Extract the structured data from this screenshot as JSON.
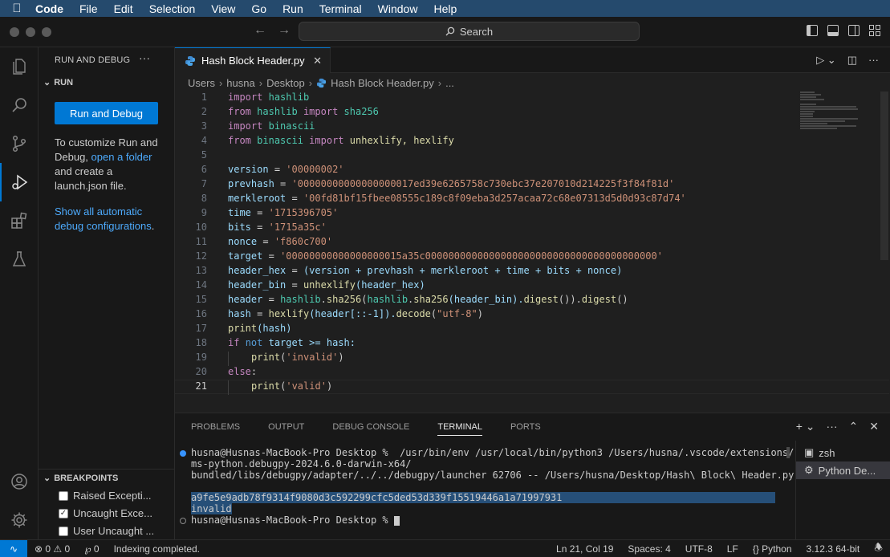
{
  "menubar": {
    "app": "Code",
    "items": [
      "File",
      "Edit",
      "Selection",
      "View",
      "Go",
      "Run",
      "Terminal",
      "Window",
      "Help"
    ]
  },
  "titlebar": {
    "search_label": "Search"
  },
  "sidebar": {
    "title": "RUN AND DEBUG",
    "run_section": "RUN",
    "run_button": "Run and Debug",
    "customize_text_1": "To customize Run and Debug, ",
    "open_folder_link": "open a folder",
    "customize_text_2": " and create a launch.json file.",
    "show_all_link": "Show all automatic debug configurations",
    "show_all_suffix": ".",
    "breakpoints_section": "BREAKPOINTS",
    "breakpoints": [
      {
        "label": "Raised Excepti...",
        "checked": false
      },
      {
        "label": "Uncaught Exce...",
        "checked": true
      },
      {
        "label": "User Uncaught ...",
        "checked": false
      }
    ]
  },
  "editor": {
    "tab_title": "Hash Block Header.py",
    "breadcrumb": [
      "Users",
      "husna",
      "Desktop",
      "Hash Block Header.py",
      "..."
    ],
    "line_numbers": [
      "1",
      "2",
      "3",
      "4",
      "5",
      "6",
      "7",
      "8",
      "9",
      "10",
      "11",
      "12",
      "13",
      "14",
      "15",
      "16",
      "17",
      "18",
      "19",
      "20",
      "21"
    ],
    "current_line": "21"
  },
  "code": {
    "l1": [
      "import",
      "hashlib"
    ],
    "l2": [
      "from",
      "hashlib",
      "import",
      "sha256"
    ],
    "l3": [
      "import",
      "binascii"
    ],
    "l4": [
      "from",
      "binascii",
      "import",
      "unhexlify, hexlify"
    ],
    "l6": [
      "version",
      "'00000002'"
    ],
    "l7": [
      "prevhash",
      "'00000000000000000017ed39e6265758c730ebc37e207010d214225f3f84f81d'"
    ],
    "l8": [
      "merkleroot",
      "'00fd81bf15fbee08555c189c8f09eba3d257acaa72c68e07313d5d0d93c87d74'"
    ],
    "l9": [
      "time",
      "'1715396705'"
    ],
    "l10": [
      "bits",
      "'1715a35c'"
    ],
    "l11": [
      "nonce",
      "'f860c700'"
    ],
    "l12": [
      "target",
      "'00000000000000000015a35c0000000000000000000000000000000000000000'"
    ],
    "l13": [
      "header_hex",
      "(version + prevhash + merkleroot + time + bits + nonce)"
    ],
    "l14": [
      "header_bin",
      "unhexlify",
      "(header_hex)"
    ],
    "l15": [
      "header",
      "hashlib",
      ".",
      "sha256",
      "(",
      "hashlib",
      ".",
      "sha256",
      "(header_bin).",
      "digest",
      "()).",
      "digest",
      "()"
    ],
    "l16": [
      "hash",
      "hexlify",
      "(header[::-1]).",
      "decode",
      "(",
      "\"utf-8\"",
      ")"
    ],
    "l17": [
      "print",
      "(hash)"
    ],
    "l18": [
      "if",
      "not",
      "target >= hash:"
    ],
    "l19": [
      "print",
      "(",
      "'invalid'",
      ")"
    ],
    "l20": [
      "else",
      ":"
    ],
    "l21": [
      "print",
      "(",
      "'valid'",
      ")"
    ]
  },
  "panel": {
    "tabs": [
      "PROBLEMS",
      "OUTPUT",
      "DEBUG CONSOLE",
      "TERMINAL",
      "PORTS"
    ],
    "active_tab": "TERMINAL",
    "terminal_lines": [
      "husna@Husnas-MacBook-Pro Desktop %  /usr/bin/env /usr/local/bin/python3 /Users/husna/.vscode/extensions/",
      "ms-python.debugpy-2024.6.0-darwin-x64/",
      "bundled/libs/debugpy/adapter/../../debugpy/launcher 62706 -- /Users/husna/Desktop/Hash\\ Block\\ Header.py",
      "a9fe5e9adb78f9314f9080d3c592299cfc5ded53d339f15519446a1a71997931",
      "invalid",
      "husna@Husnas-MacBook-Pro Desktop % "
    ],
    "terminals": [
      "zsh",
      "Python De..."
    ]
  },
  "statusbar": {
    "errors": "0",
    "warnings": "0",
    "ports": "0",
    "message": "Indexing completed.",
    "position": "Ln 21, Col 19",
    "spaces": "Spaces: 4",
    "encoding": "UTF-8",
    "eol": "LF",
    "language": "Python",
    "interpreter": "3.12.3 64-bit"
  },
  "colors": {
    "accent": "#0078d4",
    "link": "#4daafc",
    "menubar": "#254a6d"
  }
}
